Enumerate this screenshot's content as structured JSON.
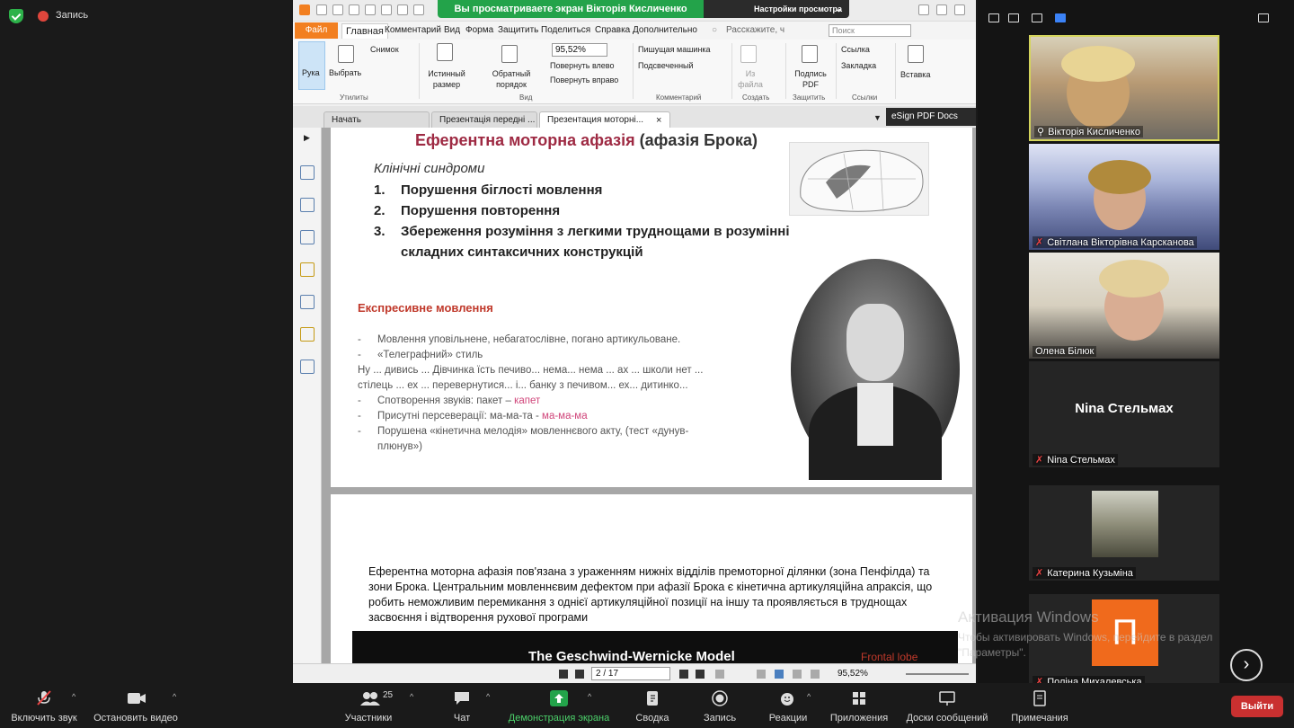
{
  "meeting": {
    "recording_label": "Запись",
    "share_banner": "Вы просматриваете экран Вікторія Кисличенко",
    "view_options": "Настройки просмотра"
  },
  "foxit": {
    "menu": [
      "Файл",
      "Главная",
      "Комментарий",
      "Вид",
      "Форма",
      "Защитить",
      "Поделиться",
      "Справка",
      "Дополнительно"
    ],
    "tell_me": "Расскажите, ч",
    "search_placeholder": "Поиск",
    "ribbon": {
      "hand": "Рука",
      "select": "Выбрать",
      "snapshot": "Снимок",
      "utilities": "Утилиты",
      "actual_size": "Истинный размер",
      "reverse_order": "Обратный порядок",
      "zoom": "95,52%",
      "rotate_left": "Повернуть влево",
      "rotate_right": "Повернуть вправо",
      "view_group": "Вид",
      "typewriter": "Пишущая машинка",
      "highlight": "Подсвеченный",
      "comment_group": "Комментарий",
      "from_file": "Из файла",
      "create_group": "Создать",
      "sign_pdf": "Подпись PDF",
      "protect_group": "Защитить",
      "link": "Ссылка",
      "bookmark": "Закладка",
      "links_group": "Ссылки",
      "insert": "Вставка"
    },
    "tabs": [
      "Начать",
      "Презентація передні ...",
      "Презентация моторні..."
    ],
    "esign": "eSign PDF Docs",
    "status": {
      "page": "2 / 17",
      "zoom": "95,52%"
    }
  },
  "slide1": {
    "title_hl": "Еферентна моторна афазія",
    "title_rest": " (афазія Брока)",
    "subtitle": "Клінічні синдроми",
    "items": [
      {
        "num": "1.",
        "text": "Порушення біглості мовлення"
      },
      {
        "num": "2.",
        "text": "Порушення повторення"
      },
      {
        "num": "3.",
        "text": "Збереження розуміння з легкими труднощами в розумінні складних синтаксичних конструкцій"
      }
    ],
    "expr_heading": "Експресивне мовлення",
    "line1": "Мовлення уповільнене, небагатослівне, погано артикульоване.",
    "line2": "«Телеграфний» стиль",
    "line3": "Ну ... дивись ... Дівчинка їсть печиво... нема... нема ... ах ... школи нет ... стілець ... ех ... перевернутися... і... банку з печивом... ех... дитинко...",
    "line4_a": "Спотворення звуків: пакет – ",
    "line4_b": "капет",
    "line5_a": "Присутні персеверації: ма-ма-та - ",
    "line5_b": "ма-ма-ма",
    "line6": "Порушена «кінетична мелодія» мовленнєвого акту, (тест «дунув-плюнув»)"
  },
  "slide2": {
    "text": "Еферентна моторна афазія пов'язана з ураженням нижніх відділів премоторної ділянки (зона Пенфілда) та зони Брока. Центральним мовленнєвим дефектом при афазії Брока є кінетична артикуляційна апраксія, що робить неможливим перемикання з однієї артикуляційної позиції на іншу та проявляється в труднощах засвоєння і відтворення рухової програми",
    "banner_title": "The Geschwind-Wernicke Model",
    "banner_label": "Frontal lobe"
  },
  "watermark": {
    "title": "Активация Windows",
    "text": "Чтобы активировать Windows, перейдите в раздел \"Параметры\"."
  },
  "participants": [
    {
      "name": "Вікторія Кисличенко",
      "video": true,
      "muted": false
    },
    {
      "name": "Світлана Вікторівна Карсканова",
      "video": true,
      "muted": true
    },
    {
      "name": "Олена Білюк",
      "video": true,
      "muted": false
    },
    {
      "name": "Nina Стельмах",
      "video": false,
      "muted": true
    },
    {
      "name": "Катерина Кузьміна",
      "video": false,
      "muted": true,
      "photo": true
    },
    {
      "name": "Поліна Михалевська",
      "video": false,
      "muted": true,
      "initial": "П"
    }
  ],
  "toolbar": {
    "unmute": "Включить звук",
    "start_video": "Остановить видео",
    "participants": "Участники",
    "participants_count": "25",
    "chat": "Чат",
    "share": "Демонстрация экрана",
    "summary": "Сводка",
    "record": "Запись",
    "reactions": "Реакции",
    "apps": "Приложения",
    "whiteboards": "Доски сообщений",
    "notes": "Примечания",
    "leave": "Выйти"
  },
  "colors": {
    "accent_green": "#23a34a",
    "leave_red": "#c93030",
    "foxit_orange": "#f27f20",
    "title_red": "#9e2a43"
  }
}
